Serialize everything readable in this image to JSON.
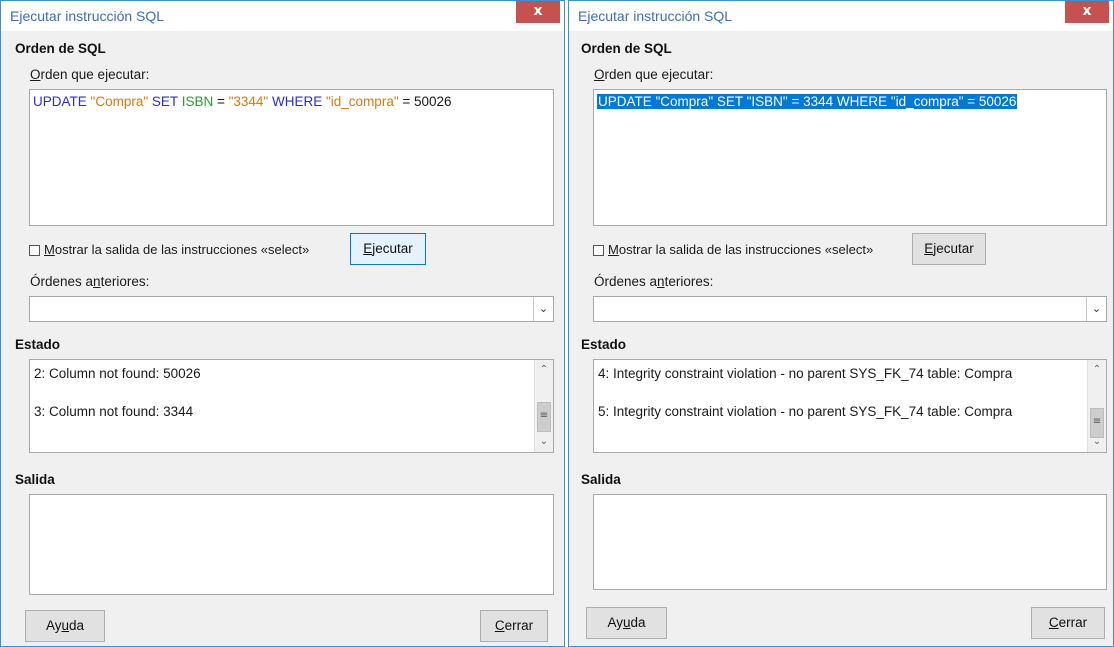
{
  "left": {
    "title": "Ejecutar instrucción SQL",
    "close_label": "x",
    "section_sql": "Orden de SQL",
    "command_label": [
      "",
      "O",
      "rden que ejecutar:"
    ],
    "sql_tokens": [
      {
        "t": "UPDATE",
        "c": "kw"
      },
      {
        "t": " ",
        "c": "num"
      },
      {
        "t": "\"Compra\"",
        "c": "str"
      },
      {
        "t": " ",
        "c": "num"
      },
      {
        "t": "SET",
        "c": "kw"
      },
      {
        "t": " ",
        "c": "num"
      },
      {
        "t": "ISBN",
        "c": "fld"
      },
      {
        "t": " = ",
        "c": "num"
      },
      {
        "t": "\"3344\"",
        "c": "str"
      },
      {
        "t": " ",
        "c": "num"
      },
      {
        "t": "WHERE",
        "c": "kw"
      },
      {
        "t": " ",
        "c": "num"
      },
      {
        "t": "\"id_compra\"",
        "c": "str"
      },
      {
        "t": " = 50026",
        "c": "num"
      }
    ],
    "show_output": [
      "",
      "M",
      "ostrar la salida de las instrucciones «select»"
    ],
    "execute": [
      "",
      "E",
      "jecutar"
    ],
    "previous_label": [
      "Órdenes a",
      "n",
      "teriores:"
    ],
    "previous_value": "",
    "section_status": "Estado",
    "status_lines": [
      "2: Column not found: 50026",
      "3: Column not found: 3344"
    ],
    "section_output": "Salida",
    "help": [
      "Ay",
      "u",
      "da"
    ],
    "close_btn": [
      "",
      "C",
      "errar"
    ]
  },
  "right": {
    "title": "Ejecutar instrucción SQL",
    "close_label": "x",
    "section_sql": "Orden de SQL",
    "command_label": [
      "",
      "O",
      "rden que ejecutar:"
    ],
    "sql_text": "UPDATE \"Compra\" SET \"ISBN\" = 3344 WHERE \"id_compra\" = 50026",
    "show_output": [
      "",
      "M",
      "ostrar la salida de las instrucciones «select»"
    ],
    "execute": [
      "",
      "E",
      "jecutar"
    ],
    "previous_label": [
      "Órdenes a",
      "n",
      "teriores:"
    ],
    "previous_value": "",
    "section_status": "Estado",
    "status_lines": [
      "4: Integrity constraint violation - no parent SYS_FK_74 table: Compra",
      "5: Integrity constraint violation - no parent SYS_FK_74 table: Compra"
    ],
    "section_output": "Salida",
    "help": [
      "Ay",
      "u",
      "da"
    ],
    "close_btn": [
      "",
      "C",
      "errar"
    ]
  },
  "colors": {
    "keyword": "#2b2bd3",
    "string": "#d47b12",
    "field": "#2a9a34",
    "selection": "#0078d7",
    "close_red": "#c75050",
    "title_blue": "#3b6fb8"
  },
  "icons": {
    "dropdown": "chevron-down-icon",
    "scroll_up": "arrow-up-icon",
    "scroll_down": "arrow-down-icon",
    "scroll_thumb": "grip-icon"
  }
}
